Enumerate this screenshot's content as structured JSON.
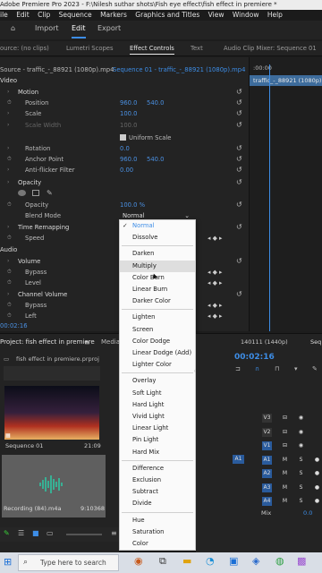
{
  "window": {
    "title": "Adobe Premiere Pro 2023 - F:\\Nilesh suthar shots\\Fish eye effect\\fish effect in premiere *"
  },
  "menu": [
    "ile",
    "Edit",
    "Clip",
    "Sequence",
    "Markers",
    "Graphics and Titles",
    "View",
    "Window",
    "Help"
  ],
  "workspaces": {
    "import": "Import",
    "edit": "Edit",
    "export": "Export"
  },
  "panel_tabs": {
    "source": "ource: (no clips)",
    "lumetri": "Lumetri Scopes",
    "effect_controls": "Effect Controls",
    "text": "Text",
    "audio_mixer": "Audio Clip Mixer: Sequence 01"
  },
  "effect_controls": {
    "source_clip": "Source - traffic_-_88921 (1080p).mp4",
    "sequence_clip": "Sequence 01 - traffic_-_88921 (1080p).mp4",
    "timecode_start": ":00:00",
    "clip_bar": "traffic_-_88921 (1080p).mp4",
    "video_header": "Video",
    "motion": "Motion",
    "position_label": "Position",
    "position_x": "960.0",
    "position_y": "540.0",
    "scale_label": "Scale",
    "scale_value": "100.0",
    "scale_width_label": "Scale Width",
    "scale_width_value": "100.0",
    "uniform_scale": "Uniform Scale",
    "rotation_label": "Rotation",
    "rotation_value": "0.0",
    "anchor_label": "Anchor Point",
    "anchor_x": "960.0",
    "anchor_y": "540.0",
    "antiflicker_label": "Anti-flicker Filter",
    "antiflicker_value": "0.00",
    "opacity": "Opacity",
    "opacity_label": "Opacity",
    "opacity_value": "100.0 %",
    "blend_label": "Blend Mode",
    "blend_value": "Normal",
    "time_remap": "Time Remapping",
    "speed_label": "Speed",
    "audio_header": "Audio",
    "volume": "Volume",
    "bypass_label": "Bypass",
    "level_label": "Level",
    "channel_volume": "Channel Volume",
    "bypass2_label": "Bypass",
    "left_label": "Left",
    "timecode": "00:02:16"
  },
  "blend_menu": {
    "groups": [
      [
        "Normal",
        "Dissolve"
      ],
      [
        "Darken",
        "Multiply",
        "Color Burn",
        "Linear Burn",
        "Darker Color"
      ],
      [
        "Lighten",
        "Screen",
        "Color Dodge",
        "Linear Dodge (Add)",
        "Lighter Color"
      ],
      [
        "Overlay",
        "Soft Light",
        "Hard Light",
        "Vivid Light",
        "Linear Light",
        "Pin Light",
        "Hard Mix"
      ],
      [
        "Difference",
        "Exclusion",
        "Subtract",
        "Divide"
      ],
      [
        "Hue",
        "Saturation",
        "Color",
        "Luminosity"
      ]
    ],
    "checked": "Normal",
    "highlighted": "Multiply"
  },
  "project": {
    "tab": "Project: fish effect in premiere",
    "tab2": "Media",
    "file": "fish effect in premiere.prproj",
    "item1_name": "Sequence 01",
    "item1_duration": "21:09",
    "item2_name": "Recording (84).m4a",
    "item2_duration": "9:10368",
    "partial_text1": "elected",
    "partial_text2": "622"
  },
  "timeline": {
    "seq_label": "140111 (1440p)",
    "tab_label": "Seq",
    "timecode": "00:02:16",
    "video_tracks": [
      "V3",
      "V2",
      "V1"
    ],
    "audio_tracks": [
      "A1",
      "A2",
      "A3",
      "A4"
    ],
    "a1_source": "A1",
    "mix_label": "Mix",
    "mix_value": "0.0"
  },
  "taskbar": {
    "search_placeholder": "Type here to search"
  },
  "colors": {
    "accent": "#3d8de6",
    "value_blue": "#4a8fe0",
    "audio_green": "#2fc4a2"
  }
}
